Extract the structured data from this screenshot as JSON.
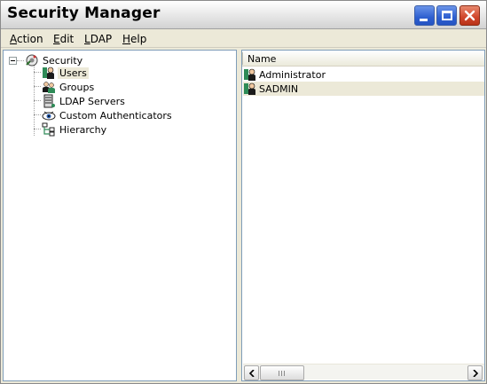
{
  "window": {
    "title": "Security Manager"
  },
  "title_buttons": {
    "minimize": "minimize-icon",
    "maximize": "maximize-icon",
    "close": "close-icon"
  },
  "menu": {
    "items": [
      {
        "label_ul": "A",
        "label_rest": "ction"
      },
      {
        "label_ul": "E",
        "label_rest": "dit"
      },
      {
        "label_ul": "L",
        "label_rest": "DAP"
      },
      {
        "label_ul": "H",
        "label_rest": "elp"
      }
    ]
  },
  "tree": {
    "root": {
      "label": "Security",
      "icon": "security-icon"
    },
    "children": [
      {
        "label": "Users",
        "icon": "user-icon",
        "selected": true
      },
      {
        "label": "Groups",
        "icon": "group-icon"
      },
      {
        "label": "LDAP Servers",
        "icon": "ldap-server-icon"
      },
      {
        "label": "Custom Authenticators",
        "icon": "authenticator-icon"
      },
      {
        "label": "Hierarchy",
        "icon": "hierarchy-icon"
      }
    ]
  },
  "list": {
    "columns": [
      "Name"
    ],
    "rows": [
      {
        "name": "Administrator",
        "icon": "user-icon"
      },
      {
        "name": "SADMIN",
        "icon": "user-icon",
        "selected": true
      }
    ]
  },
  "colors": {
    "selection": "#ece9d8",
    "title_button_blue": "#2e5fd0",
    "close_button_red": "#d0452a",
    "pane_border": "#7f9db9"
  }
}
